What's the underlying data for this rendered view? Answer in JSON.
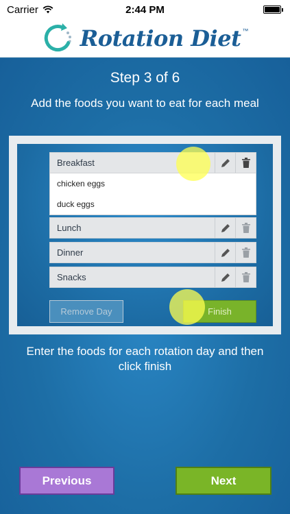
{
  "status_bar": {
    "carrier": "Carrier",
    "time": "2:44 PM"
  },
  "header": {
    "logo_text": "Rotation Diet",
    "trademark": "™"
  },
  "step": {
    "title": "Step 3 of 6",
    "description": "Add the foods you want to eat for each meal"
  },
  "meals": [
    {
      "label": "Breakfast",
      "foods": [
        "chicken eggs",
        "duck eggs"
      ]
    },
    {
      "label": "Lunch",
      "foods": []
    },
    {
      "label": "Dinner",
      "foods": []
    },
    {
      "label": "Snacks",
      "foods": []
    }
  ],
  "actions": {
    "remove_day": "Remove Day",
    "finish": "Finish"
  },
  "instructions": "Enter the foods for each rotation day and then click finish",
  "nav": {
    "previous": "Previous",
    "next": "Next"
  },
  "colors": {
    "background_blue": "#1d6ea6",
    "brand_blue": "#1b5e96",
    "finish_green": "#79b32a",
    "next_green": "#7ab527",
    "previous_purple": "#a978d6",
    "highlight_yellow": "#ffff50"
  },
  "icons": {
    "edit": "pencil-icon",
    "delete": "trash-icon",
    "wifi": "wifi-icon",
    "battery": "battery-icon"
  }
}
